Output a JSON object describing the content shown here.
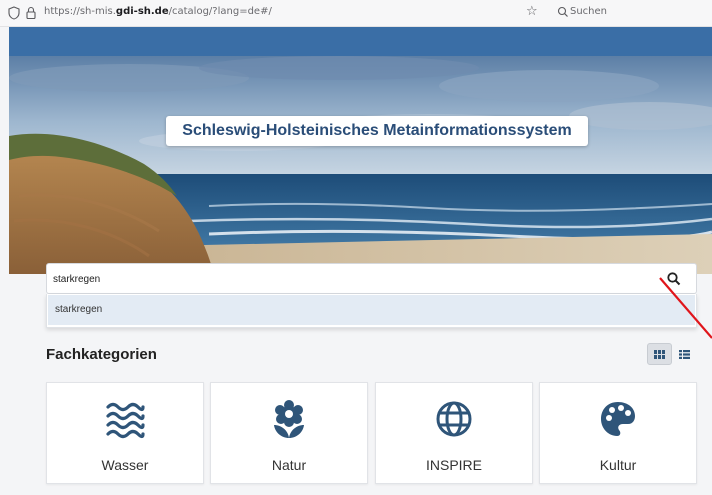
{
  "browser": {
    "url_prefix": "https://sh-mis.",
    "url_domain": "gdi-sh.de",
    "url_path": "/catalog/?lang=de#/",
    "search_placeholder": "Suchen"
  },
  "hero": {
    "title": "Schleswig-Holsteinisches Metainformationssystem"
  },
  "search": {
    "value": "starkregen",
    "suggestion": "starkregen"
  },
  "categories_section": {
    "title": "Fachkategorien",
    "view_modes": [
      "grid",
      "list"
    ],
    "active_view": "grid"
  },
  "categories": [
    {
      "label": "Wasser",
      "icon": "water-waves-icon"
    },
    {
      "label": "Natur",
      "icon": "flower-icon"
    },
    {
      "label": "INSPIRE",
      "icon": "globe-icon"
    },
    {
      "label": "Kultur",
      "icon": "palette-icon"
    }
  ],
  "colors": {
    "accent": "#3a6ea6",
    "icon": "#2f5579",
    "title_text": "#2a4d78",
    "annotation": "#e0151b"
  }
}
